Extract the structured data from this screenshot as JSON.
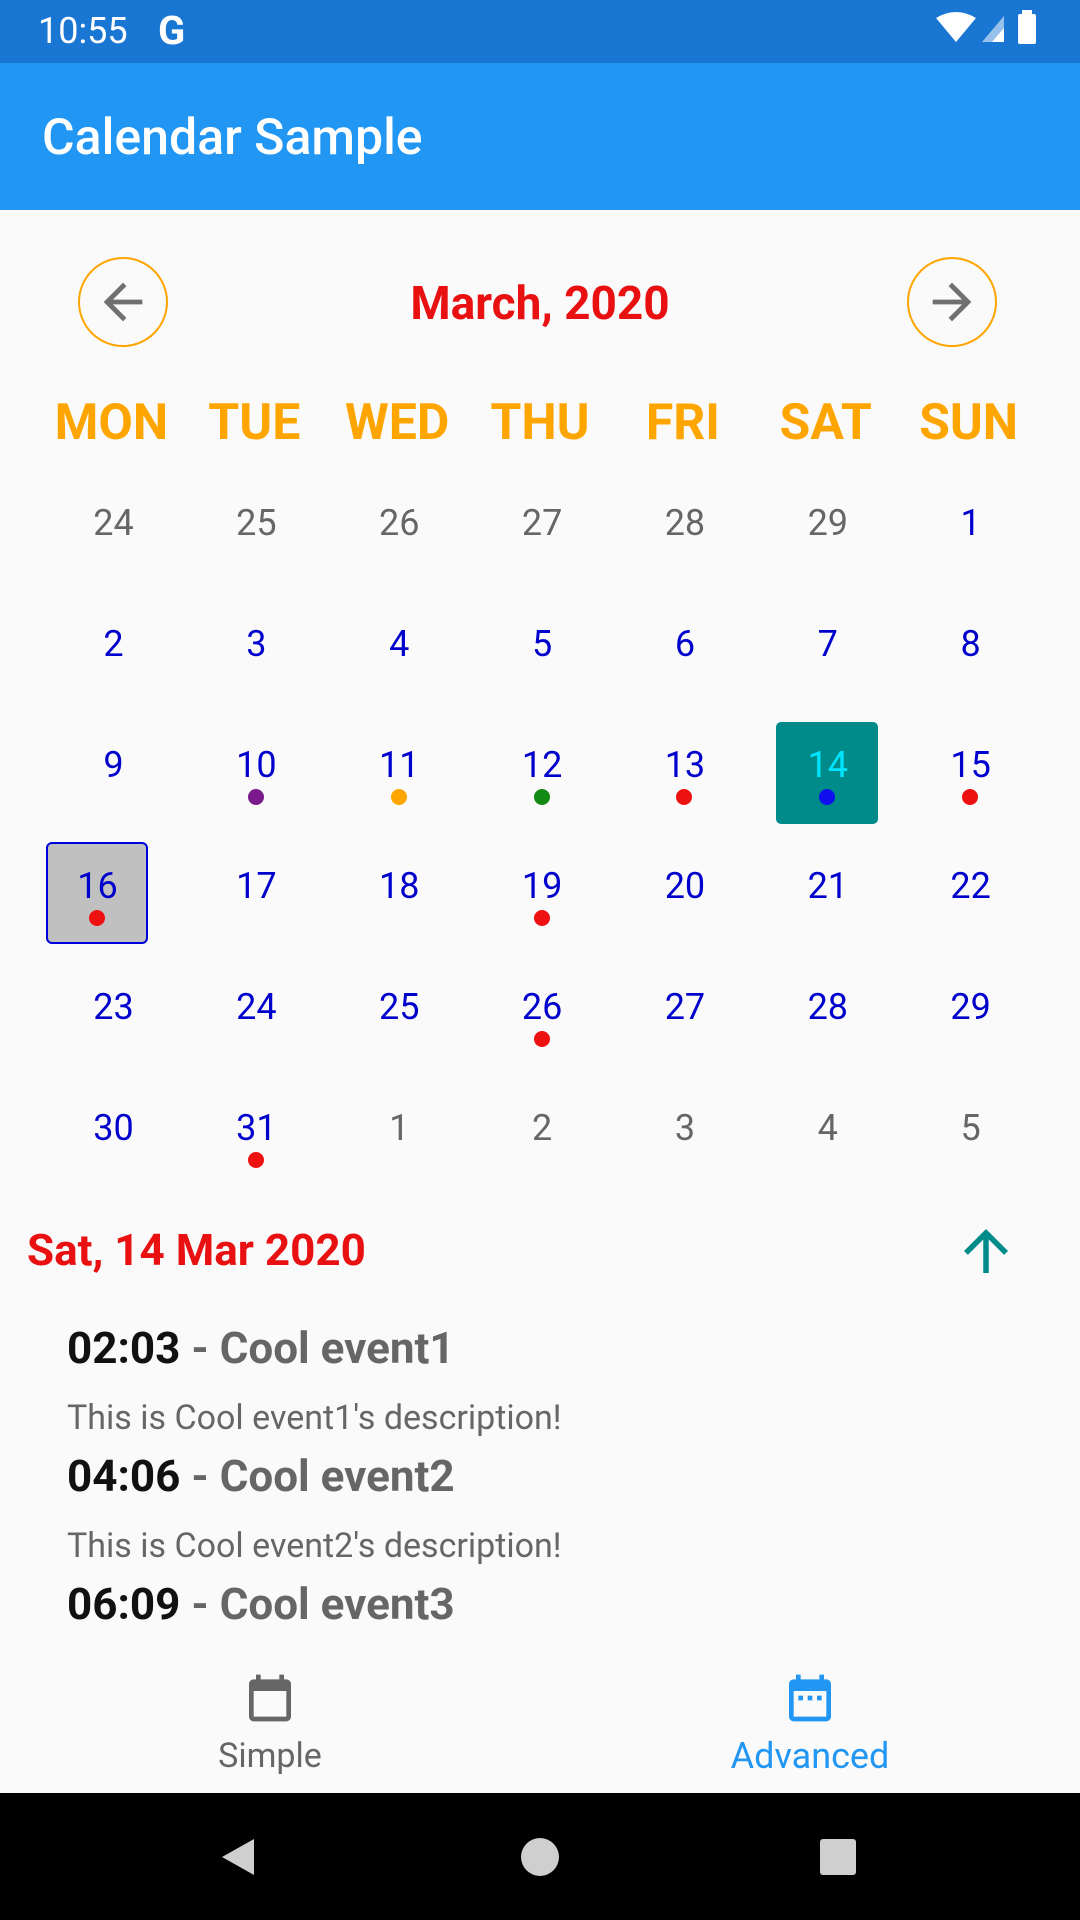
{
  "status_bar": {
    "time": "10:55",
    "g_letter": "G"
  },
  "app_bar": {
    "title": "Calendar Sample"
  },
  "calendar": {
    "month_title": "March, 2020",
    "weekdays": [
      "MON",
      "TUE",
      "WED",
      "THU",
      "FRI",
      "SAT",
      "SUN"
    ],
    "weeks": [
      [
        {
          "n": "24",
          "m": "other"
        },
        {
          "n": "25",
          "m": "other"
        },
        {
          "n": "26",
          "m": "other"
        },
        {
          "n": "27",
          "m": "other"
        },
        {
          "n": "28",
          "m": "other"
        },
        {
          "n": "29",
          "m": "other"
        },
        {
          "n": "1",
          "m": "cur"
        }
      ],
      [
        {
          "n": "2",
          "m": "cur"
        },
        {
          "n": "3",
          "m": "cur"
        },
        {
          "n": "4",
          "m": "cur"
        },
        {
          "n": "5",
          "m": "cur"
        },
        {
          "n": "6",
          "m": "cur"
        },
        {
          "n": "7",
          "m": "cur"
        },
        {
          "n": "8",
          "m": "cur"
        }
      ],
      [
        {
          "n": "9",
          "m": "cur"
        },
        {
          "n": "10",
          "m": "cur",
          "dot": "#7b1a8a"
        },
        {
          "n": "11",
          "m": "cur",
          "dot": "#ffa500"
        },
        {
          "n": "12",
          "m": "cur",
          "dot": "#138a13"
        },
        {
          "n": "13",
          "m": "cur",
          "dot": "#ee1111"
        },
        {
          "n": "14",
          "m": "cur",
          "dot": "#1010ee",
          "today": true
        },
        {
          "n": "15",
          "m": "cur",
          "dot": "#ee1111"
        }
      ],
      [
        {
          "n": "16",
          "m": "cur",
          "dot": "#ee1111",
          "selected": true
        },
        {
          "n": "17",
          "m": "cur"
        },
        {
          "n": "18",
          "m": "cur"
        },
        {
          "n": "19",
          "m": "cur",
          "dot": "#ee1111"
        },
        {
          "n": "20",
          "m": "cur"
        },
        {
          "n": "21",
          "m": "cur"
        },
        {
          "n": "22",
          "m": "cur"
        }
      ],
      [
        {
          "n": "23",
          "m": "cur"
        },
        {
          "n": "24",
          "m": "cur"
        },
        {
          "n": "25",
          "m": "cur"
        },
        {
          "n": "26",
          "m": "cur",
          "dot": "#ee1111"
        },
        {
          "n": "27",
          "m": "cur"
        },
        {
          "n": "28",
          "m": "cur"
        },
        {
          "n": "29",
          "m": "cur"
        }
      ],
      [
        {
          "n": "30",
          "m": "cur"
        },
        {
          "n": "31",
          "m": "cur",
          "dot": "#ee1111"
        },
        {
          "n": "1",
          "m": "other"
        },
        {
          "n": "2",
          "m": "other"
        },
        {
          "n": "3",
          "m": "other"
        },
        {
          "n": "4",
          "m": "other"
        },
        {
          "n": "5",
          "m": "other"
        }
      ]
    ]
  },
  "selected_date": "Sat, 14 Mar 2020",
  "events": [
    {
      "time": "02:03",
      "dash": "-",
      "title": "Cool event1",
      "description": "This is Cool event1's description!"
    },
    {
      "time": "04:06",
      "dash": "-",
      "title": "Cool event2",
      "description": "This is Cool event2's description!"
    },
    {
      "time": "06:09",
      "dash": "-",
      "title": "Cool event3",
      "description": ""
    }
  ],
  "bottom_nav": {
    "tabs": [
      {
        "label": "Simple",
        "icon": "calendar-blank-icon",
        "active": false
      },
      {
        "label": "Advanced",
        "icon": "calendar-dots-icon",
        "active": true
      }
    ]
  },
  "colors": {
    "status_bar": "#1976d2",
    "app_bar": "#2196f3",
    "month_title": "#e81010",
    "weekday": "#ffa500",
    "today_fill": "#008b8b",
    "accent": "#2196f3"
  }
}
